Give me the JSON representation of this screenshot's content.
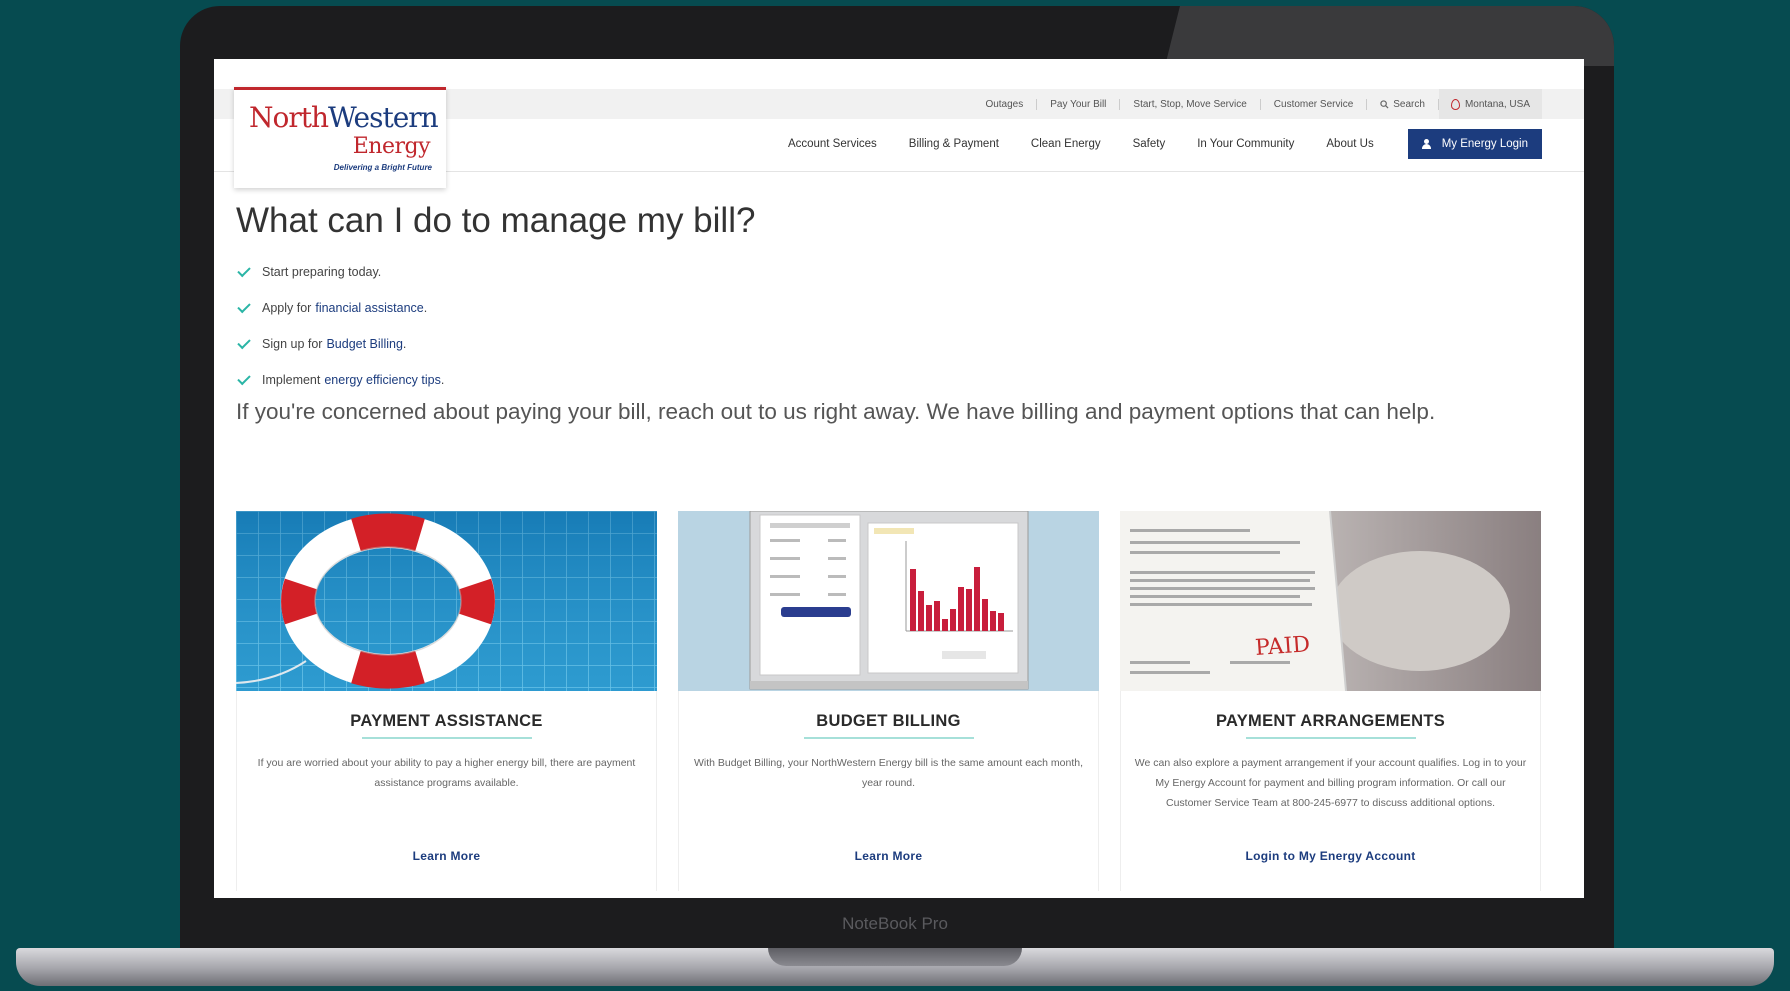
{
  "device": {
    "label": "NoteBook Pro"
  },
  "header": {
    "utility": {
      "outages": "Outages",
      "pay_bill": "Pay Your Bill",
      "start_stop": "Start, Stop, Move Service",
      "customer_service": "Customer Service",
      "search": "Search",
      "location": "Montana, USA"
    },
    "nav": {
      "account_services": "Account Services",
      "billing_payment": "Billing & Payment",
      "clean_energy": "Clean Energy",
      "safety": "Safety",
      "community": "In Your Community",
      "about": "About Us",
      "login": "My Energy Login"
    },
    "logo": {
      "north": "North",
      "western": "Western",
      "energy": "Energy",
      "tagline": "Delivering a Bright Future"
    }
  },
  "content": {
    "title": "What can I do to manage my bill?",
    "checklist": [
      {
        "text": "Start preparing today.",
        "link": "",
        "after": ""
      },
      {
        "text": "Apply for",
        "link": "financial assistance",
        "after": "."
      },
      {
        "text": "Sign up for",
        "link": "Budget Billing",
        "after": "."
      },
      {
        "text": "Implement",
        "link": "energy efficiency tips",
        "after": "."
      }
    ],
    "concern": "If you're concerned about paying your bill, reach out to us right away. We have billing and payment options that can help."
  },
  "cards": [
    {
      "title": "PAYMENT ASSISTANCE",
      "text": "If you are worried about your ability to pay a higher energy bill, there are payment assistance programs available.",
      "link": "Learn More"
    },
    {
      "title": "BUDGET BILLING",
      "text": "With Budget Billing, your NorthWestern Energy bill is the same amount each month, year round.",
      "link": "Learn More"
    },
    {
      "title": "PAYMENT ARRANGEMENTS",
      "text": "We can also explore a payment arrangement if your account qualifies. Log in to your My Energy Account for payment and billing program information. Or call our Customer Service Team at 800-245-6977 to discuss additional options.",
      "link": "Login to My Energy Account",
      "stamp": "PAID"
    }
  ],
  "colors": {
    "background": "#064b50",
    "brand_red": "#c0272d",
    "brand_navy": "#1c3c7e",
    "accent_teal": "#2bb5a6"
  }
}
